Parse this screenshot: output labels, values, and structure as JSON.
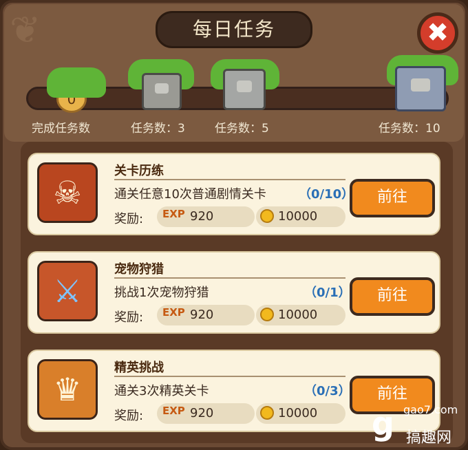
{
  "window": {
    "title": "每日任务"
  },
  "progress": {
    "completed_count": "0",
    "completed_label": "完成任务数",
    "fraction": 0,
    "milestones": [
      {
        "label": "任务数：3"
      },
      {
        "label": "任务数：5"
      },
      {
        "label": "任务数：10"
      }
    ]
  },
  "tasks": [
    {
      "title": "关卡历练",
      "description": "通关任意10次普通剧情关卡",
      "progress": "（0/10）",
      "reward_label": "奖励:",
      "exp_tag": "EXP",
      "exp_value": "920",
      "gold_value": "10000",
      "button_label": "前往",
      "icon": "skull-crossed-swords-icon"
    },
    {
      "title": "宠物狩猎",
      "description": "挑战1次宠物狩猎",
      "progress": "（0/1）",
      "reward_label": "奖励:",
      "exp_tag": "EXP",
      "exp_value": "920",
      "gold_value": "10000",
      "button_label": "前往",
      "icon": "pet-spear-icon"
    },
    {
      "title": "精英挑战",
      "description": "通关3次精英关卡",
      "progress": "（0/3）",
      "reward_label": "奖励:",
      "exp_tag": "EXP",
      "exp_value": "920",
      "gold_value": "10000",
      "button_label": "前往",
      "icon": "crowned-skull-icon"
    }
  ],
  "watermark": {
    "url": "gao7.com",
    "name": "搞趣网"
  },
  "colors": {
    "accent": "#f18a1e",
    "progress_blue": "#2a6fb6",
    "close_red": "#d43d2b"
  }
}
